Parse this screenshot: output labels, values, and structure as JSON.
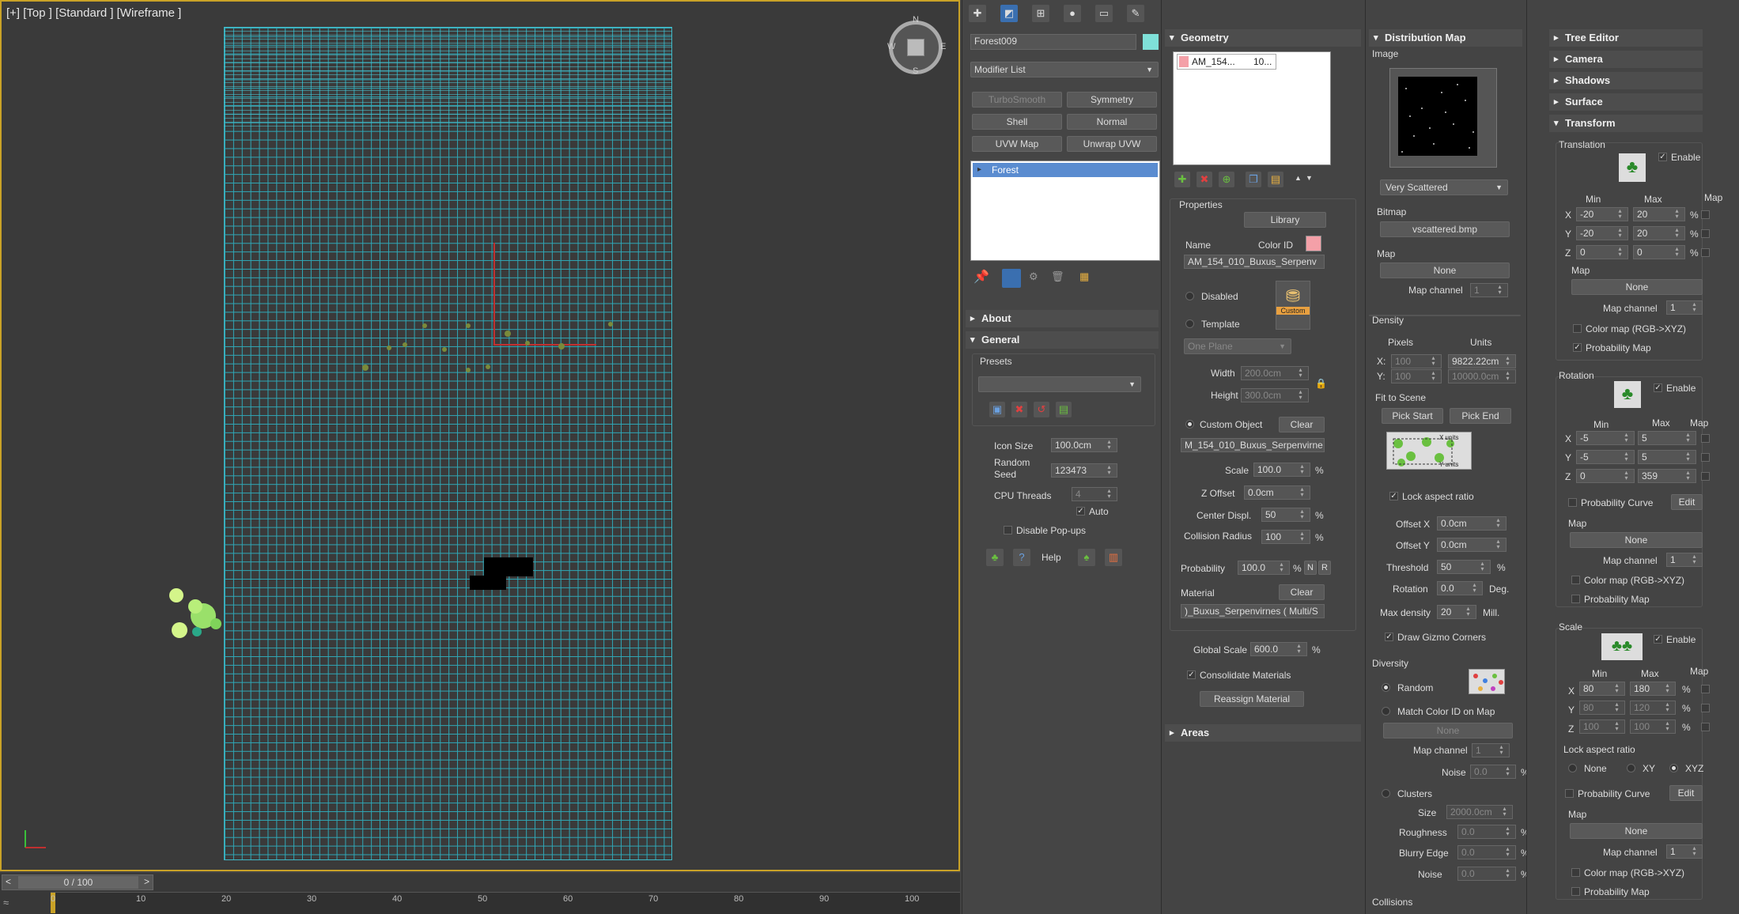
{
  "viewport": {
    "label": "[+] [Top ] [Standard ] [Wireframe ]",
    "compass": {
      "n": "N",
      "s": "S",
      "e": "E",
      "w": "W"
    }
  },
  "timeline": {
    "frame": "0 / 100",
    "prev": "<",
    "next": ">",
    "ticks": [
      "0",
      "10",
      "20",
      "30",
      "40",
      "50",
      "60",
      "70",
      "80",
      "90",
      "100"
    ]
  },
  "modify": {
    "object_name": "Forest009",
    "object_color": "#7fe0d8",
    "modifier_list": "Modifier List",
    "buttons": [
      "TurboSmooth",
      "Symmetry",
      "Shell",
      "Normal",
      "UVW Map",
      "Unwrap UVW"
    ],
    "stack_item": "Forest",
    "rollouts": {
      "about": "About",
      "general": "General"
    },
    "general": {
      "presets": "Presets",
      "icon_size_label": "Icon Size",
      "icon_size": "100.0cm",
      "seed_label": "Random\nSeed",
      "seed": "123473",
      "cpu_label": "CPU Threads",
      "cpu": "4",
      "auto": "Auto",
      "disable_popups": "Disable Pop-ups",
      "help": "Help"
    }
  },
  "geometry": {
    "title": "Geometry",
    "list_item": "AM_154...",
    "list_item_value": "10...",
    "properties": "Properties",
    "library": "Library",
    "name_label": "Name",
    "colorid_label": "Color ID",
    "colorid": "#f4a0a8",
    "name_value": "AM_154_010_Buxus_Serpenv",
    "disabled": "Disabled",
    "template": "Template",
    "custom_badge": "Custom",
    "one_plane": "One Plane",
    "width_label": "Width",
    "width": "200.0cm",
    "height_label": "Height",
    "height": "300.0cm",
    "custom_object": "Custom Object",
    "clear": "Clear",
    "custom_value": "M_154_010_Buxus_Serpenvirne",
    "scale_label": "Scale",
    "scale": "100.0",
    "zoffset_label": "Z Offset",
    "zoffset": "0.0cm",
    "center_label": "Center Displ.",
    "center": "50",
    "collision_label": "Collision Radius",
    "collision": "100",
    "prob_label": "Probability",
    "prob": "100.0",
    "n": "N",
    "r": "R",
    "material_label": "Material",
    "material_clear": "Clear",
    "material_value": ")_Buxus_Serpenvirnes  ( Multi/S",
    "global_scale_label": "Global Scale",
    "global_scale": "600.0",
    "consolidate": "Consolidate Materials",
    "reassign": "Reassign Material",
    "areas": "Areas",
    "pct": "%"
  },
  "distribution": {
    "title": "Distribution Map",
    "image": "Image",
    "preset": "Very Scattered",
    "bitmap_label": "Bitmap",
    "bitmap": "vscattered.bmp",
    "map_label": "Map",
    "map": "None",
    "map_channel_label": "Map channel",
    "map_channel": "1",
    "density": "Density",
    "pixels": "Pixels",
    "units": "Units",
    "x": "X:",
    "y": "Y:",
    "px_x": "100",
    "px_y": "100",
    "u_x": "9822.22cm",
    "u_y": "10000.0cm",
    "fit": "Fit to Scene",
    "pick_start": "Pick Start",
    "pick_end": "Pick End",
    "xunits": "X units",
    "yunits": "Y units",
    "lock_aspect": "Lock aspect ratio",
    "offx_label": "Offset X",
    "offx": "0.0cm",
    "offy_label": "Offset Y",
    "offy": "0.0cm",
    "threshold_label": "Threshold",
    "threshold": "50",
    "rotation_label": "Rotation",
    "rotation": "0.0",
    "deg": "Deg.",
    "maxdens_label": "Max density",
    "maxdens": "20",
    "mill": "Mill.",
    "draw_gizmo": "Draw Gizmo Corners",
    "diversity": "Diversity",
    "random": "Random",
    "match_color": "Match Color ID on Map",
    "div_map": "None",
    "div_channel": "1",
    "noise_label": "Noise",
    "noise": "0.0",
    "clusters": "Clusters",
    "size_label": "Size",
    "size": "2000.0cm",
    "rough_label": "Roughness",
    "rough": "0.0",
    "blurry_label": "Blurry Edge",
    "blurry": "0.0",
    "noise2": "0.0",
    "collisions": "Collisions",
    "pct": "%"
  },
  "tree": {
    "rollouts": [
      "Tree Editor",
      "Camera",
      "Shadows",
      "Surface"
    ],
    "transform": "Transform",
    "translation": "Translation",
    "enable": "Enable",
    "min": "Min",
    "max": "Max",
    "map": "Map",
    "pct": "%",
    "t_x": [
      "-20",
      "20"
    ],
    "t_y": [
      "-20",
      "20"
    ],
    "t_z": [
      "0",
      "0"
    ],
    "none": "None",
    "map_channel": "Map channel",
    "channel": "1",
    "colormap": "Color map (RGB->XYZ)",
    "probmap": "Probability Map",
    "rotation": "Rotation",
    "r_x": [
      "-5",
      "5"
    ],
    "r_y": [
      "-5",
      "5"
    ],
    "r_z": [
      "0",
      "359"
    ],
    "prob_curve": "Probability Curve",
    "edit": "Edit",
    "scale": "Scale",
    "s_x": [
      "80",
      "180"
    ],
    "s_y": [
      "80",
      "120"
    ],
    "s_z": [
      "100",
      "100"
    ],
    "lock": "Lock aspect ratio",
    "lock_none": "None",
    "lock_xy": "XY",
    "lock_xyz": "XYZ",
    "axis_x": "X",
    "axis_y": "Y",
    "axis_z": "Z"
  }
}
